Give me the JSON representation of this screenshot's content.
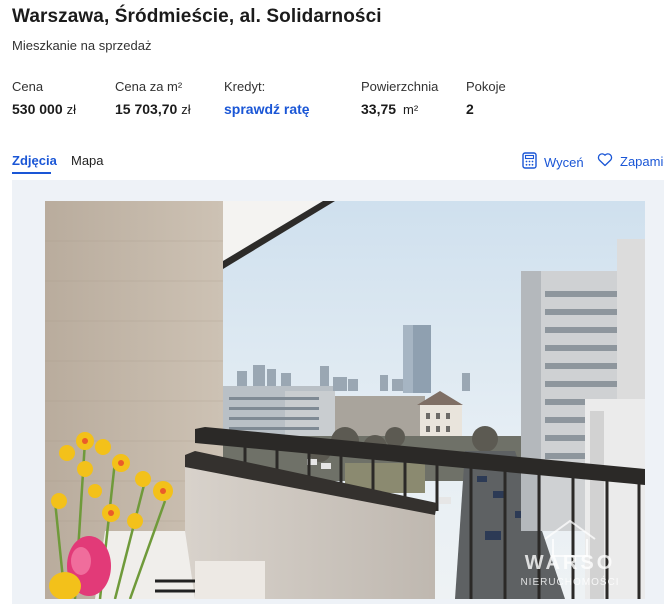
{
  "listing": {
    "title": "Warszawa, Śródmieście, al. Solidarności",
    "subtitle": "Mieszkanie na sprzedaż"
  },
  "stats": {
    "price_label": "Cena",
    "price_value": "530 000",
    "price_unit": "zł",
    "price_m2_label": "Cena za m²",
    "price_m2_value": "15 703,70",
    "price_m2_unit": "zł",
    "credit_label": "Kredyt:",
    "credit_link": "sprawdź ratę",
    "area_label": "Powierzchnia",
    "area_value": "33,75",
    "area_unit": "m²",
    "rooms_label": "Pokoje",
    "rooms_value": "2"
  },
  "tabs": [
    {
      "label": "Zdjęcia",
      "active": true
    },
    {
      "label": "Mapa",
      "active": false
    }
  ],
  "actions": {
    "valuation_label": "Wyceń",
    "valuation_icon": "calculator-icon",
    "save_label": "Zapamiętaj",
    "save_icon": "heart-icon"
  },
  "photo": {
    "watermark_line1": "WARSO",
    "watermark_line2": "NIERUCHOMOŚCI"
  },
  "colors": {
    "accent": "#1a56d6",
    "gallery_background": "#eef2f7"
  }
}
